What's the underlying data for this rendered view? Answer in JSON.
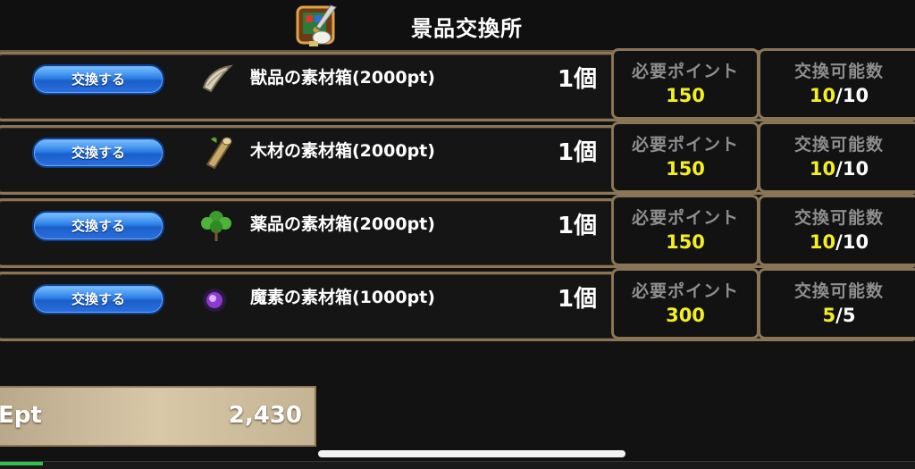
{
  "header": {
    "title": "景品交換所",
    "icon": "sword-shop-icon"
  },
  "columns": {
    "required_points_label": "必要ポイント",
    "exchangeable_label": "交換可能数"
  },
  "items": [
    {
      "button_label": "交換する",
      "icon": "horn-icon",
      "name": "獣品の素材箱(2000pt)",
      "quantity": "1個",
      "required_points": "150",
      "remaining": "10",
      "total": "/10"
    },
    {
      "button_label": "交換する",
      "icon": "wood-log-icon",
      "name": "木材の素材箱(2000pt)",
      "quantity": "1個",
      "required_points": "150",
      "remaining": "10",
      "total": "/10"
    },
    {
      "button_label": "交換する",
      "icon": "herb-leaf-icon",
      "name": "薬品の素材箱(2000pt)",
      "quantity": "1個",
      "required_points": "150",
      "remaining": "10",
      "total": "/10"
    },
    {
      "button_label": "交換する",
      "icon": "magic-orb-icon",
      "name": "魔素の素材箱(1000pt)",
      "quantity": "1個",
      "required_points": "300",
      "remaining": "5",
      "total": "/5"
    }
  ],
  "points": {
    "label": "Ept",
    "value": "2,430"
  },
  "colors": {
    "accent_yellow": "#f3ef24",
    "button_blue": "#2c7fe8",
    "frame_brown": "#8a7556"
  }
}
